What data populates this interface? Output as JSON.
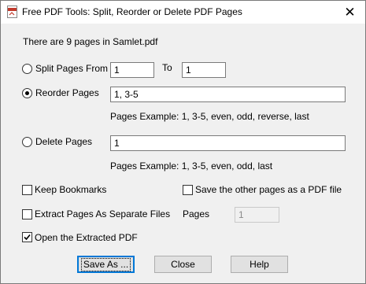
{
  "window": {
    "title": "Free PDF Tools: Split, Reorder or Delete PDF Pages",
    "close_glyph": "✕"
  },
  "info": {
    "text": "There are 9 pages in Samlet.pdf"
  },
  "split": {
    "label": "Split Pages From",
    "from_value": "1",
    "to_label": "To",
    "to_value": "1",
    "selected": false
  },
  "reorder": {
    "label": "Reorder Pages",
    "value": "1, 3-5",
    "example": "Pages Example: 1, 3-5, even, odd, reverse, last",
    "selected": true
  },
  "delete": {
    "label": "Delete Pages",
    "value": "1",
    "example": "Pages Example: 1, 3-5, even, odd, last",
    "selected": false
  },
  "options": {
    "keep_bookmarks": {
      "label": "Keep Bookmarks",
      "checked": false
    },
    "save_other_pages": {
      "label": "Save the other pages as a PDF file",
      "checked": false
    },
    "extract_separate": {
      "label": "Extract Pages As Separate Files",
      "checked": false
    },
    "pages_label": "Pages",
    "pages_value": "1",
    "open_extracted": {
      "label": "Open the Extracted PDF",
      "checked": true
    }
  },
  "buttons": {
    "save_as": "Save As ...",
    "close": "Close",
    "help": "Help"
  },
  "colors": {
    "focus_border": "#0078d7",
    "dialog_bg": "#f0f0f0"
  }
}
